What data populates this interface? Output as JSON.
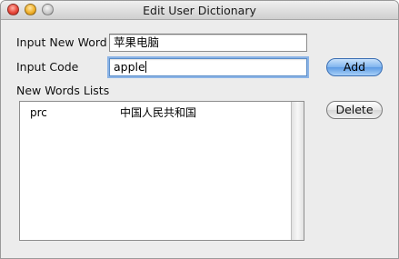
{
  "window": {
    "title": "Edit User Dictionary"
  },
  "form": {
    "new_word_label": "Input New Word",
    "new_word_value": "苹果电脑",
    "code_label": "Input Code",
    "code_value": "apple",
    "list_label": "New Words Lists"
  },
  "buttons": {
    "add_label": "Add",
    "delete_label": "Delete"
  },
  "word_list": [
    {
      "code": "prc",
      "word": "中国人民共和国"
    }
  ]
}
